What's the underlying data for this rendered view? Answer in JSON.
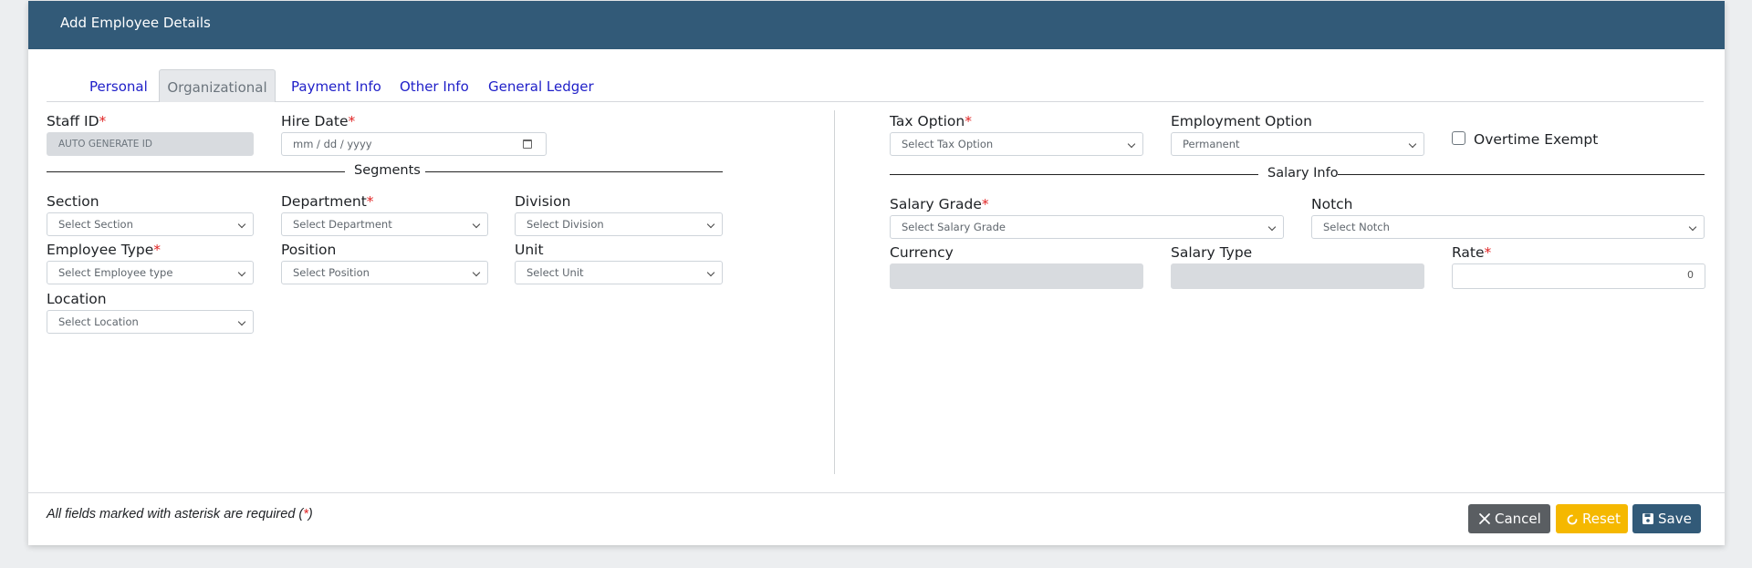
{
  "header": {
    "title": "Add Employee Details"
  },
  "tabs": [
    {
      "label": "Personal"
    },
    {
      "label": "Organizational"
    },
    {
      "label": "Payment Info"
    },
    {
      "label": "Other Info"
    },
    {
      "label": "General Ledger"
    }
  ],
  "left": {
    "staff_id": {
      "label": "Staff ID",
      "value": "AUTO GENERATE ID"
    },
    "hire_date": {
      "label": "Hire Date",
      "placeholder": "mm / dd / yyyy"
    },
    "segments_title": "Segments",
    "section": {
      "label": "Section",
      "value": "Select Section"
    },
    "department": {
      "label": "Department",
      "value": "Select Department"
    },
    "division": {
      "label": "Division",
      "value": "Select Division"
    },
    "employee_type": {
      "label": "Employee Type",
      "value": "Select Employee type"
    },
    "position": {
      "label": "Position",
      "value": "Select Position"
    },
    "unit": {
      "label": "Unit",
      "value": "Select Unit"
    },
    "location": {
      "label": "Location",
      "value": "Select Location"
    }
  },
  "right": {
    "tax_option": {
      "label": "Tax Option",
      "value": "Select Tax Option"
    },
    "employment_option": {
      "label": "Employment Option",
      "value": "Permanent"
    },
    "overtime_exempt": {
      "label": "Overtime Exempt",
      "checked": false
    },
    "salary_info_title": "Salary Info",
    "salary_grade": {
      "label": "Salary Grade",
      "value": "Select Salary Grade"
    },
    "notch": {
      "label": "Notch",
      "value": "Select Notch"
    },
    "currency": {
      "label": "Currency",
      "value": ""
    },
    "salary_type": {
      "label": "Salary Type",
      "value": ""
    },
    "rate": {
      "label": "Rate",
      "value": "0"
    }
  },
  "required_marker": "*",
  "footer": {
    "note_prefix": "All fields marked with asterisk are required (",
    "note_star": "*",
    "note_suffix": ")",
    "cancel_label": "Cancel",
    "reset_label": "Reset",
    "save_label": "Save"
  },
  "colors": {
    "header": "#325a78",
    "required": "#e02424",
    "tab_link": "#1f1fc8",
    "cancel": "#5a5e62",
    "reset": "#f5b800",
    "save": "#325a78"
  },
  "icons": {
    "cancel": "close-icon",
    "reset": "refresh-icon",
    "save": "floppy-disk-icon",
    "select": "chevron-down-icon",
    "date": "calendar-icon"
  }
}
